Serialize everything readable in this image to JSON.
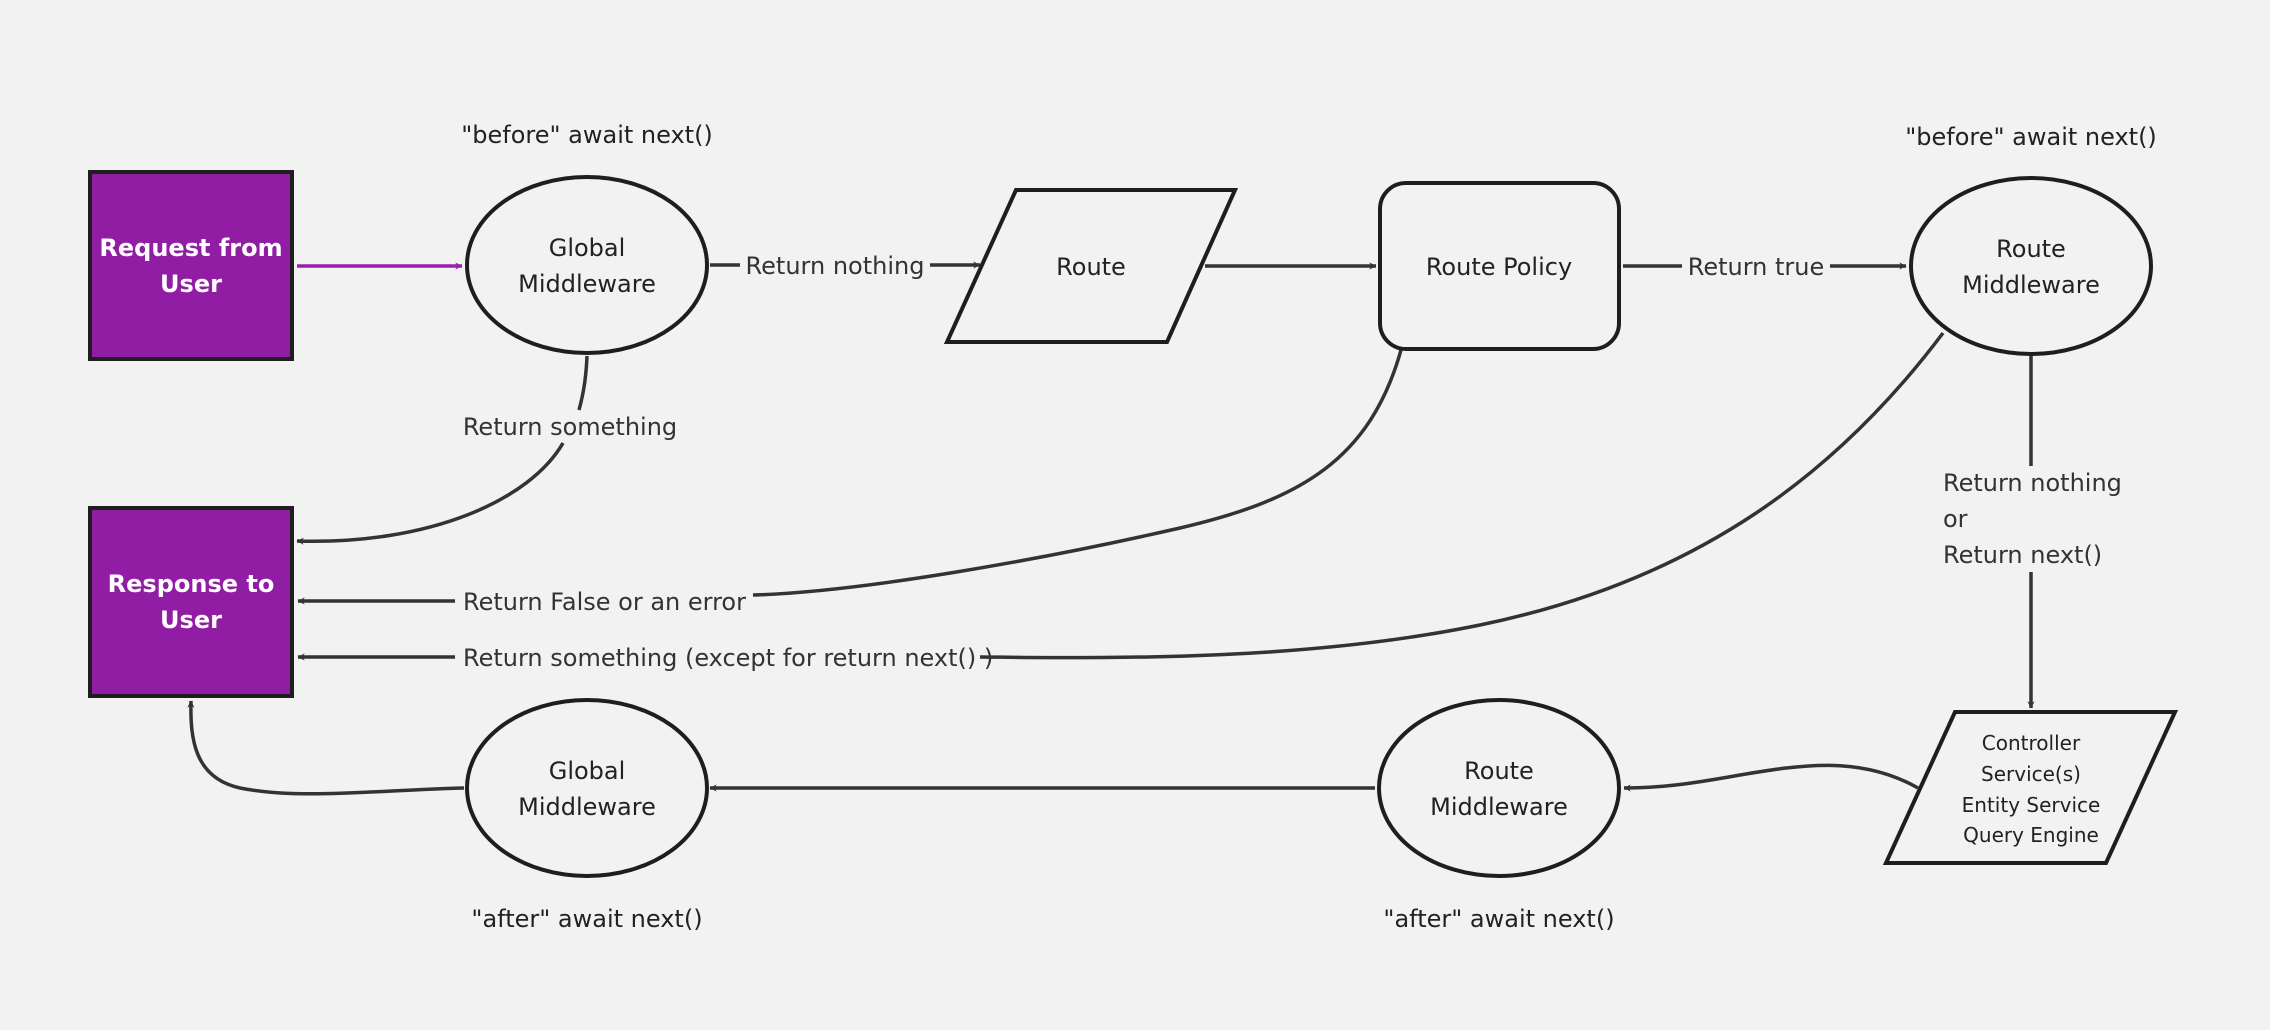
{
  "colors": {
    "background": "#f2f2f2",
    "terminal_fill": "#921da5",
    "terminal_text": "#ffffff",
    "request_arrow": "#9a1fb0",
    "edge": "#333333",
    "outline": "#1e1e1e"
  },
  "nodes": {
    "request": {
      "lines": [
        "Request from",
        "User"
      ],
      "shape": "rectangle"
    },
    "response": {
      "lines": [
        "Response to",
        "User"
      ],
      "shape": "rectangle"
    },
    "global_mw_before": {
      "lines": [
        "Global",
        "Middleware"
      ],
      "shape": "ellipse"
    },
    "route": {
      "lines": [
        "Route"
      ],
      "shape": "parallelogram"
    },
    "route_policy": {
      "lines": [
        "Route Policy"
      ],
      "shape": "rounded-rectangle"
    },
    "route_mw_before": {
      "lines": [
        "Route",
        "Middleware"
      ],
      "shape": "ellipse"
    },
    "controller": {
      "lines": [
        "Controller",
        "Service(s)",
        "Entity Service",
        "Query Engine"
      ],
      "shape": "parallelogram"
    },
    "route_mw_after": {
      "lines": [
        "Route",
        "Middleware"
      ],
      "shape": "ellipse"
    },
    "global_mw_after": {
      "lines": [
        "Global",
        "Middleware"
      ],
      "shape": "ellipse"
    }
  },
  "annotations": {
    "global_before": "\"before\" await next()",
    "route_before": "\"before\" await next()",
    "global_after": "\"after\" await next()",
    "route_after": "\"after\" await next()"
  },
  "edges": [
    {
      "from": "request",
      "to": "global_mw_before",
      "label": ""
    },
    {
      "from": "global_mw_before",
      "to": "route",
      "label": "Return nothing"
    },
    {
      "from": "route",
      "to": "route_policy",
      "label": ""
    },
    {
      "from": "route_policy",
      "to": "route_mw_before",
      "label": "Return true"
    },
    {
      "from": "global_mw_before",
      "to": "response",
      "label": "Return something"
    },
    {
      "from": "route_policy",
      "to": "response",
      "label": "Return False or an error"
    },
    {
      "from": "route_mw_before",
      "to": "response",
      "label": "Return something (except for return next() )"
    },
    {
      "from": "route_mw_before",
      "to": "controller",
      "label_lines": [
        "Return nothing",
        "or",
        "Return next()"
      ]
    },
    {
      "from": "controller",
      "to": "route_mw_after",
      "label": ""
    },
    {
      "from": "route_mw_after",
      "to": "global_mw_after",
      "label": ""
    },
    {
      "from": "global_mw_after",
      "to": "response",
      "label": ""
    }
  ]
}
